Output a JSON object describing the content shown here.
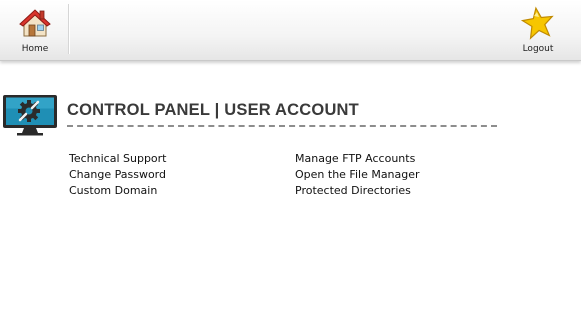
{
  "toolbar": {
    "home_label": "Home",
    "home_icon": "house-icon",
    "logout_label": "Logout",
    "logout_icon": "star-icon"
  },
  "panel": {
    "icon": "monitor-gear-icon",
    "title": "CONTROL PANEL | USER ACCOUNT",
    "links_left": [
      "Technical Support",
      "Change Password",
      "Custom Domain"
    ],
    "links_right": [
      "Manage FTP Accounts",
      "Open the File Manager",
      "Protected Directories"
    ]
  },
  "colors": {
    "title": "#3a3a3a",
    "monitor": "#1f8fb5",
    "star": "#f7c600",
    "roof": "#d9342b"
  }
}
